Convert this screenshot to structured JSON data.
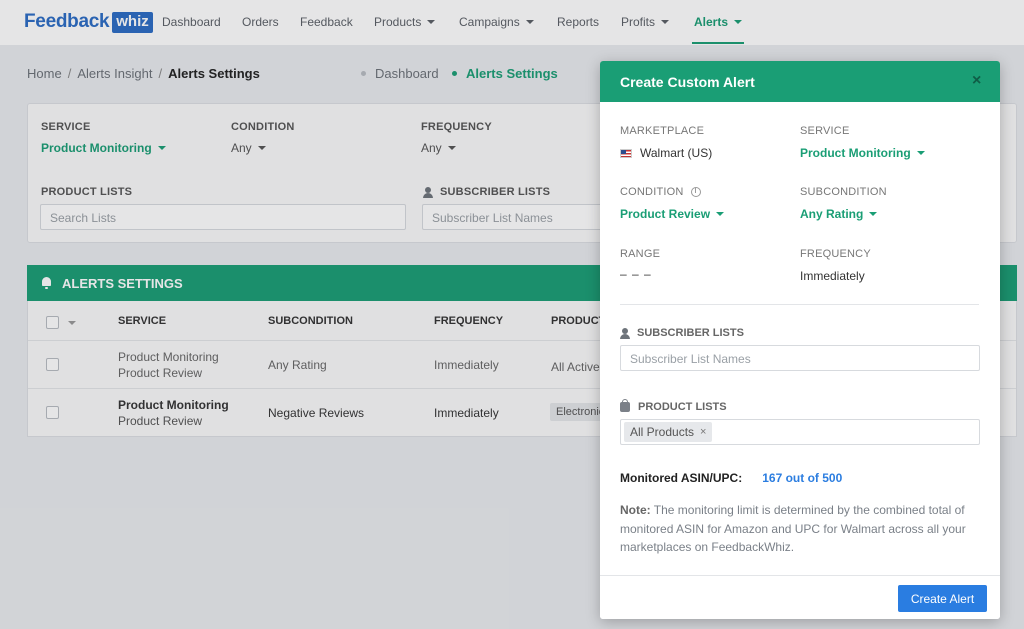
{
  "nav": {
    "logo_text": "Feedback",
    "logo_badge": "whiz",
    "items": [
      "Dashboard",
      "Orders",
      "Feedback",
      "Products",
      "Campaigns",
      "Reports",
      "Profits",
      "Alerts"
    ]
  },
  "breadcrumb": {
    "home": "Home",
    "sep": "/",
    "insight": "Alerts Insight",
    "current": "Alerts Settings"
  },
  "subnav": {
    "dashboard": "Dashboard",
    "settings": "Alerts Settings"
  },
  "filters": {
    "service_label": "SERVICE",
    "service_value": "Product Monitoring",
    "condition_label": "CONDITION",
    "condition_value": "Any",
    "frequency_label": "FREQUENCY",
    "frequency_value": "Any",
    "product_lists_label": "PRODUCT LISTS",
    "product_lists_placeholder": "Search Lists",
    "subscriber_lists_label": "SUBSCRIBER LISTS",
    "subscriber_lists_placeholder": "Subscriber List Names"
  },
  "table": {
    "title": "ALERTS SETTINGS",
    "columns": [
      "SERVICE",
      "SUBCONDITION",
      "FREQUENCY",
      "PRODUCT"
    ],
    "rows": [
      {
        "service": "Product Monitoring",
        "condition": "Product Review",
        "subcondition": "Any Rating",
        "frequency": "Immediately",
        "product": "All Active"
      },
      {
        "service": "Product Monitoring",
        "condition": "Product Review",
        "subcondition": "Negative Reviews",
        "frequency": "Immediately",
        "product": "Electronic"
      }
    ]
  },
  "modal": {
    "title": "Create Custom Alert",
    "close_glyph": "×",
    "marketplace_label": "MARKETPLACE",
    "marketplace_value": "Walmart (US)",
    "service_label": "SERVICE",
    "service_value": "Product Monitoring",
    "condition_label": "CONDITION",
    "condition_value": "Product Review",
    "subcondition_label": "SUBCONDITION",
    "subcondition_value": "Any Rating",
    "range_label": "RANGE",
    "range_value": "– – –",
    "frequency_label": "FREQUENCY",
    "frequency_value": "Immediately",
    "subscriber_lists_label": "SUBSCRIBER LISTS",
    "subscriber_lists_placeholder": "Subscriber List Names",
    "product_lists_label": "PRODUCT LISTS",
    "product_tag": "All Products",
    "product_tag_remove": "×",
    "monitored_label": "Monitored ASIN/UPC:",
    "monitored_value": "167 out of 500",
    "note_bold": "Note:",
    "note_text": " The monitoring limit is determined by the combined total of monitored ASIN for Amazon and UPC for Walmart across all your marketplaces on FeedbackWhiz.",
    "create_button": "Create Alert"
  },
  "colors": {
    "accent_green": "#1a9e75",
    "button_blue": "#2a7de1",
    "link_blue": "#2b7de0"
  }
}
